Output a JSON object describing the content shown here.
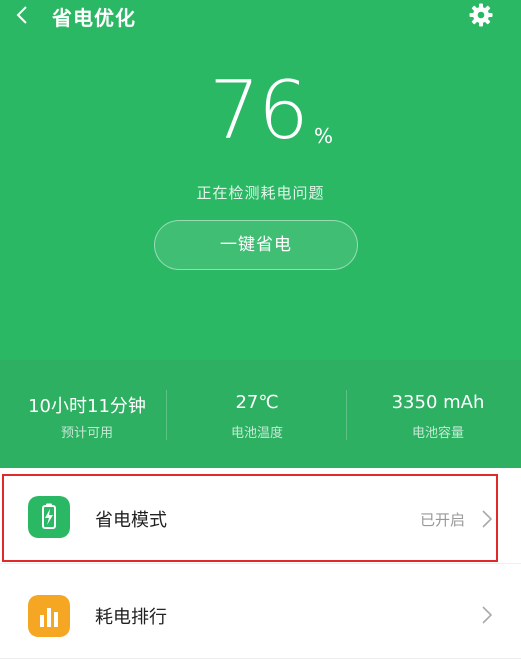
{
  "topbar": {
    "title": "省电优化",
    "back_icon": "back-chevron-icon",
    "settings_icon": "gear-icon"
  },
  "battery": {
    "percent": "76",
    "percent_sign": "%",
    "status": "正在检测耗电问题",
    "action_button": "一键省电"
  },
  "stats": [
    {
      "value": "10小时11分钟",
      "label": "预计可用"
    },
    {
      "value": "27℃",
      "label": "电池温度"
    },
    {
      "value": "3350 mAh",
      "label": "电池容量"
    }
  ],
  "list": [
    {
      "label": "省电模式",
      "value": "已开启",
      "icon": "battery-lightning-icon",
      "icon_color": "#2bb865"
    },
    {
      "label": "耗电排行",
      "value": "",
      "icon": "bar-chart-icon",
      "icon_color": "#f5a623"
    }
  ],
  "colors": {
    "accent_green": "#2bb865",
    "highlight_red": "#e02a2a"
  }
}
